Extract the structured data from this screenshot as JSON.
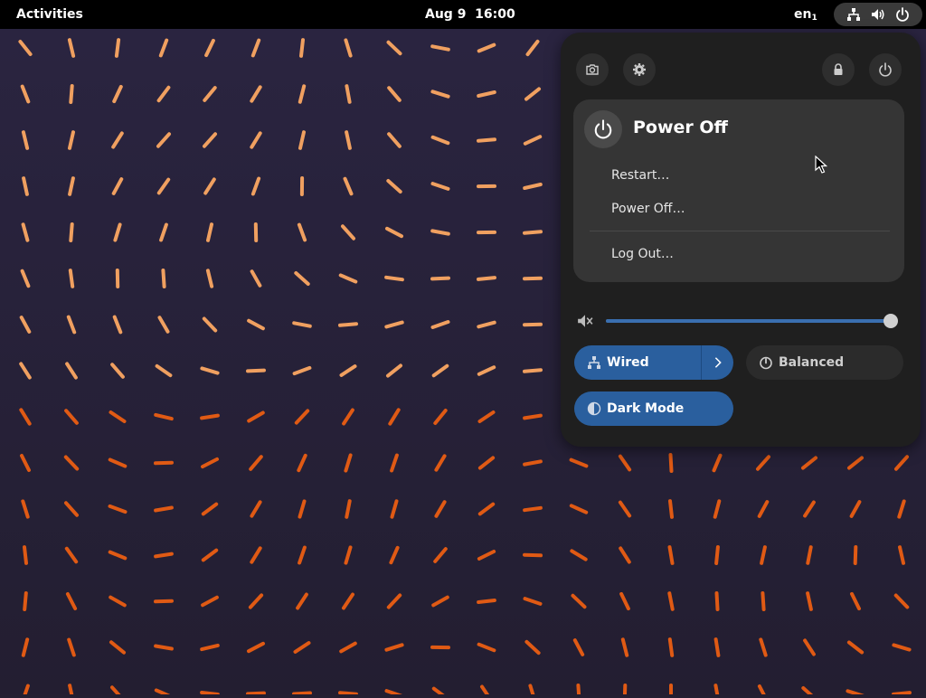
{
  "topbar": {
    "activities_label": "Activities",
    "clock": "Aug 9  16:00",
    "keyboard_layout": "en",
    "keyboard_layout_index": "1",
    "status_icons": [
      "network-wired-icon",
      "volume-icon",
      "power-icon"
    ]
  },
  "quick_settings": {
    "header_buttons": [
      "screenshot-icon",
      "settings-icon",
      "lock-icon",
      "power-icon"
    ],
    "power_menu": {
      "title": "Power Off",
      "items": [
        "Restart…",
        "Power Off…",
        "Log Out…"
      ]
    },
    "volume": {
      "icon": "volume-muted-icon",
      "level": 1.0
    },
    "toggles": {
      "wired": {
        "label": "Wired",
        "active": true
      },
      "power_mode": {
        "label": "Balanced",
        "active": false
      },
      "dark_mode": {
        "label": "Dark Mode",
        "active": true
      }
    }
  },
  "colors": {
    "accent": "#2a5f9e",
    "wallpaper_bg": "#241f31",
    "wallpaper_stroke_light": "#f0a060",
    "wallpaper_stroke_dark": "#e05a14"
  }
}
